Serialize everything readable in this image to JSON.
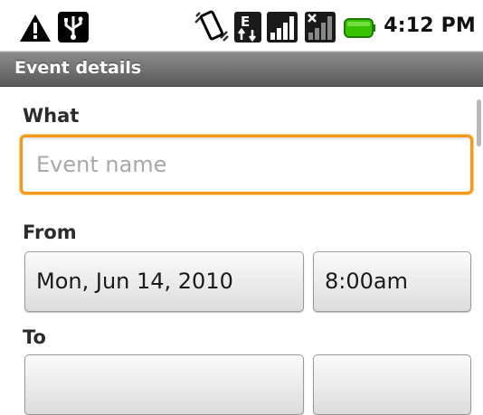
{
  "status_bar": {
    "icons": [
      "alert-icon",
      "usb-icon",
      "vibrate-icon",
      "edge-data-icon",
      "signal-strength-icon",
      "no-sim-signal-icon",
      "battery-icon"
    ],
    "time": "4:12 PM",
    "battery_color": "#38c500"
  },
  "title_bar": {
    "title": "Event details"
  },
  "form": {
    "what_label": "What",
    "event_name_placeholder": "Event name",
    "event_name_value": "",
    "from_label": "From",
    "from_date": "Mon, Jun 14, 2010",
    "from_time": "8:00am",
    "to_label": "To",
    "to_date": "",
    "to_time": ""
  },
  "colors": {
    "focus_accent": "#f29a1f",
    "title_bar": "#7a7a7a"
  }
}
